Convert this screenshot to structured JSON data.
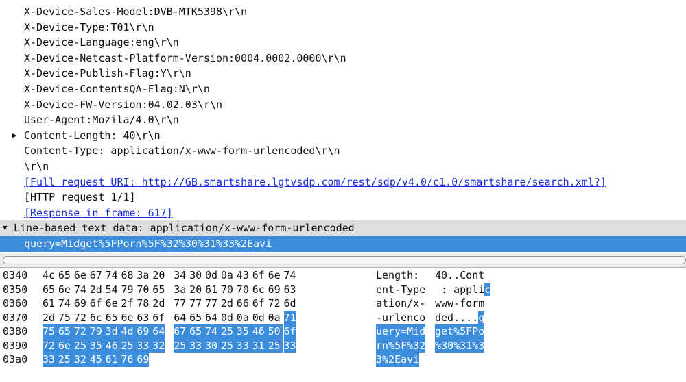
{
  "packet_details": {
    "rows": [
      {
        "text": "X-Device-Sales-Model:DVB-MTK5398\\r\\n"
      },
      {
        "text": "X-Device-Type:T01\\r\\n"
      },
      {
        "text": "X-Device-Language:eng\\r\\n"
      },
      {
        "text": "X-Device-Netcast-Platform-Version:0004.0002.0000\\r\\n"
      },
      {
        "text": "X-Device-Publish-Flag:Y\\r\\n"
      },
      {
        "text": "X-Device-ContentsQA-Flag:N\\r\\n"
      },
      {
        "text": "X-Device-FW-Version:04.02.03\\r\\n"
      },
      {
        "text": "User-Agent:Mozila/4.0\\r\\n"
      },
      {
        "text": "Content-Length: 40\\r\\n",
        "expander": "collapsed"
      },
      {
        "text": "Content-Type: application/x-www-form-urlencoded\\r\\n"
      },
      {
        "text": "\\r\\n"
      },
      {
        "text": "[Full request URI: http://GB.smartshare.lgtvsdp.com/rest/sdp/v4.0/c1.0/smartshare/search.xml?]",
        "link": true
      },
      {
        "text": "[HTTP request 1/1]"
      },
      {
        "text": "[Response in frame: 617]",
        "link": true
      },
      {
        "text": "Line-based text data: application/x-www-form-urlencoded",
        "expander": "expanded",
        "section": true
      },
      {
        "text": "query=Midget%5FPorn%5F%32%30%31%33%2Eavi",
        "selected": true
      }
    ]
  },
  "hex_dump": {
    "rows": [
      {
        "offset": "0340",
        "bytes": [
          "4c",
          "65",
          "6e",
          "67",
          "74",
          "68",
          "3a",
          "20",
          "34",
          "30",
          "0d",
          "0a",
          "43",
          "6f",
          "6e",
          "74"
        ],
        "ascii": [
          "Length: ",
          "40..Cont"
        ],
        "sel_from": 16
      },
      {
        "offset": "0350",
        "bytes": [
          "65",
          "6e",
          "74",
          "2d",
          "54",
          "79",
          "70",
          "65",
          "3a",
          "20",
          "61",
          "70",
          "70",
          "6c",
          "69",
          "63"
        ],
        "ascii": [
          "ent-Type",
          " : applic"
        ],
        "sel_from": 16
      },
      {
        "offset": "0360",
        "bytes": [
          "61",
          "74",
          "69",
          "6f",
          "6e",
          "2f",
          "78",
          "2d",
          "77",
          "77",
          "77",
          "2d",
          "66",
          "6f",
          "72",
          "6d"
        ],
        "ascii": [
          "ation/x-",
          "www-form"
        ],
        "sel_from": 16
      },
      {
        "offset": "0370",
        "bytes": [
          "2d",
          "75",
          "72",
          "6c",
          "65",
          "6e",
          "63",
          "6f",
          "64",
          "65",
          "64",
          "0d",
          "0a",
          "0d",
          "0a",
          "71"
        ],
        "ascii": [
          "-urlenco",
          "ded....q"
        ],
        "sel_from": 15
      },
      {
        "offset": "0380",
        "bytes": [
          "75",
          "65",
          "72",
          "79",
          "3d",
          "4d",
          "69",
          "64",
          "67",
          "65",
          "74",
          "25",
          "35",
          "46",
          "50",
          "6f"
        ],
        "ascii": [
          "uery=Mid",
          "get%5FPo"
        ],
        "sel_from": 0
      },
      {
        "offset": "0390",
        "bytes": [
          "72",
          "6e",
          "25",
          "35",
          "46",
          "25",
          "33",
          "32",
          "25",
          "33",
          "30",
          "25",
          "33",
          "31",
          "25",
          "33"
        ],
        "ascii": [
          "rn%5F%32",
          "%30%31%3"
        ],
        "sel_from": 0
      },
      {
        "offset": "03a0",
        "bytes": [
          "33",
          "25",
          "32",
          "45",
          "61",
          "76",
          "69"
        ],
        "ascii": [
          "3%2Eavi",
          ""
        ],
        "sel_from": 0
      }
    ]
  }
}
